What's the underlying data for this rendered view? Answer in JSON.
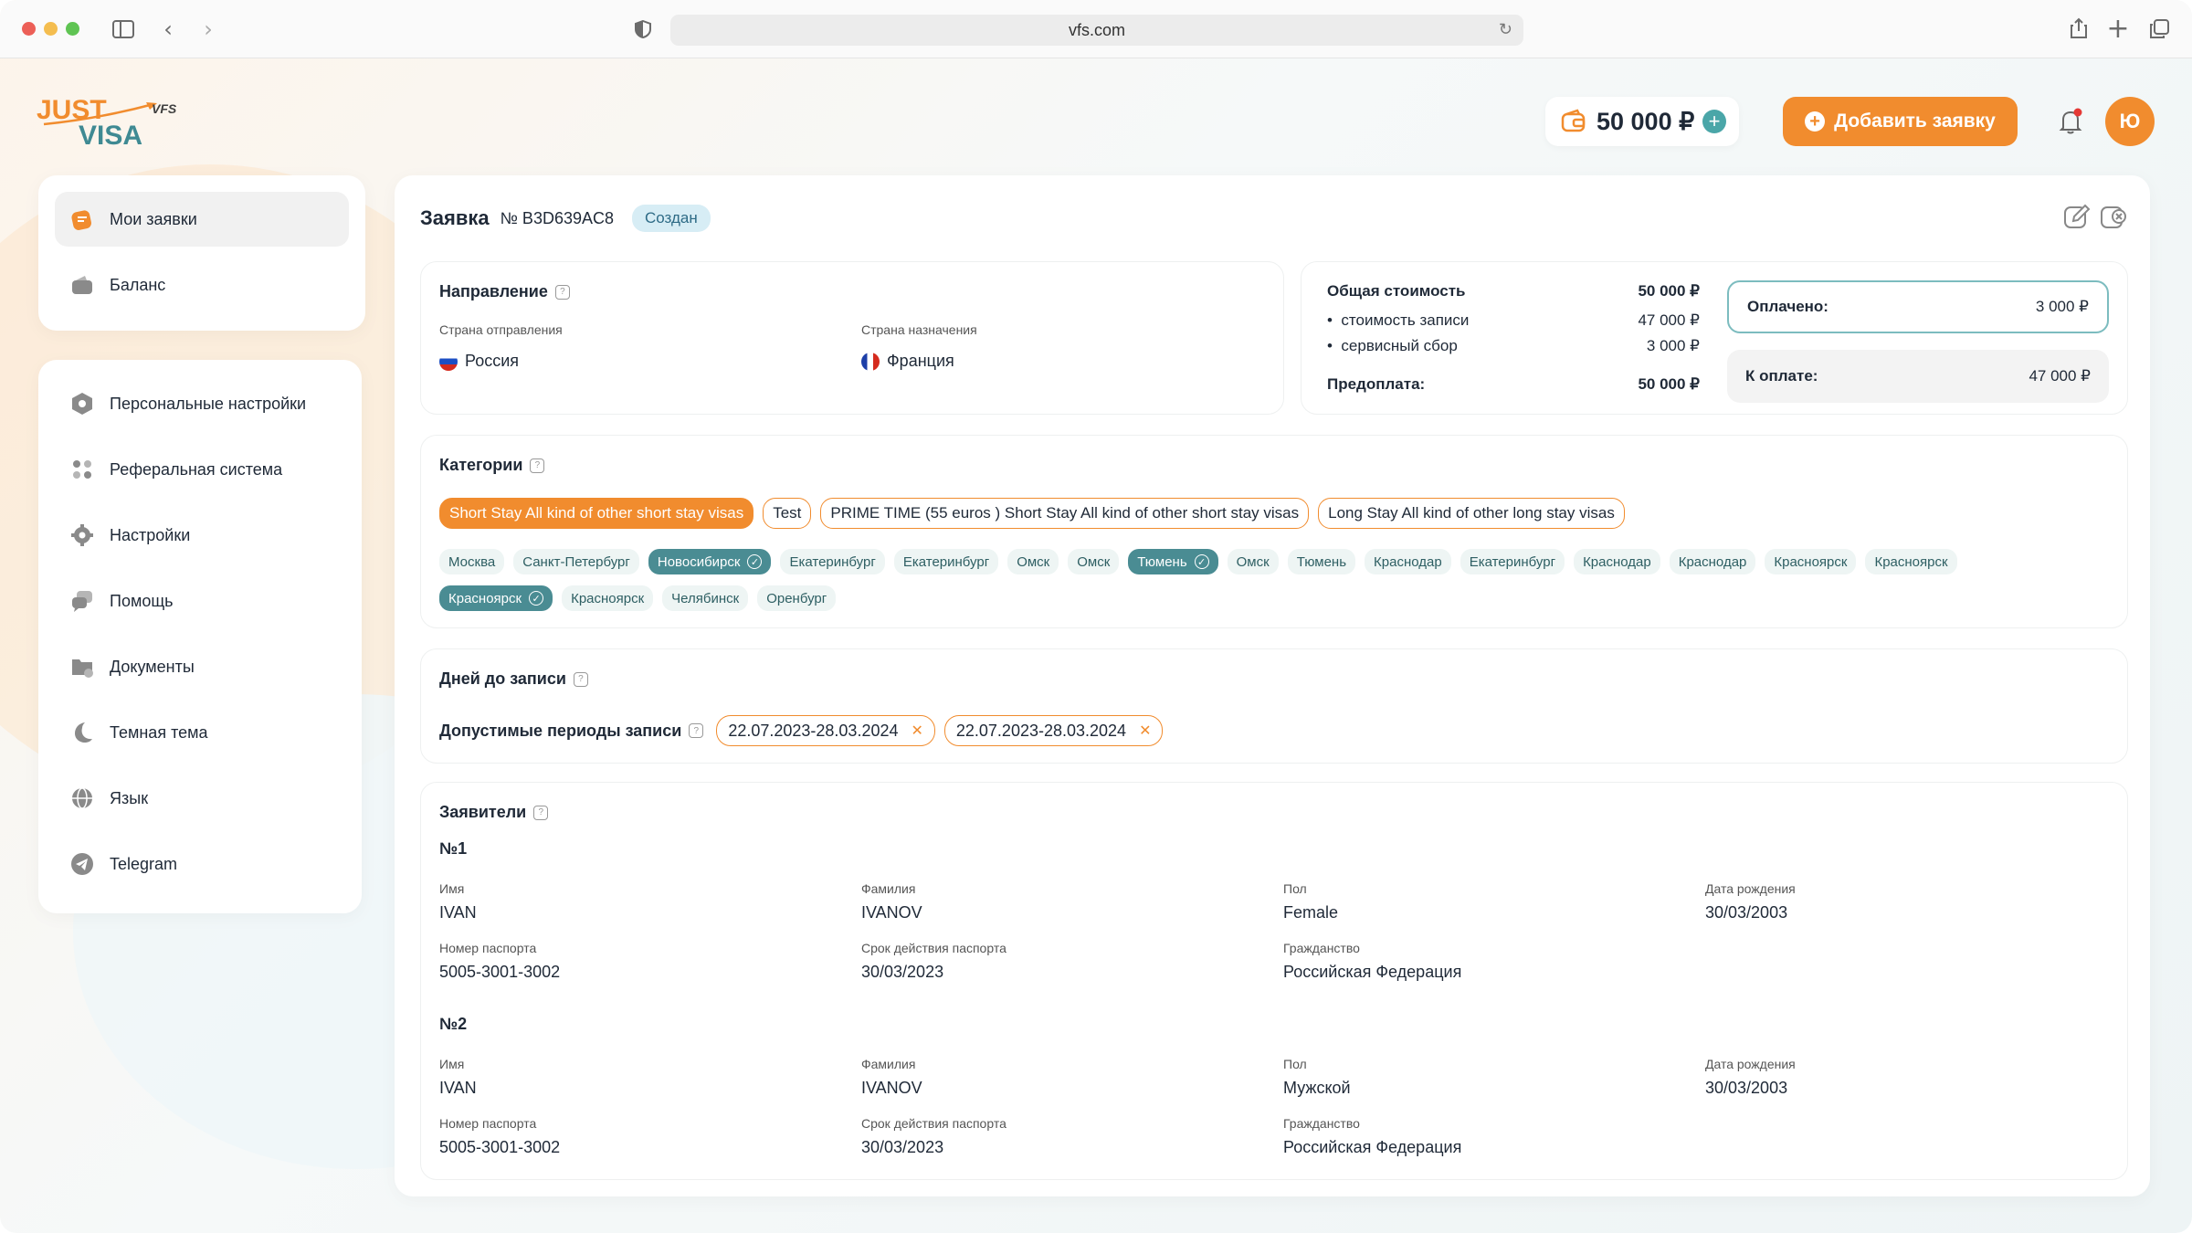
{
  "browser": {
    "url": "vfs.com"
  },
  "logo": {
    "just": "JUST",
    "visa": "VISA",
    "vfs": "VFS"
  },
  "header": {
    "balance": "50 000 ₽",
    "add_label": "Добавить заявку",
    "avatar": "Ю"
  },
  "sidebar": {
    "top": [
      {
        "label": "Мои заявки",
        "icon": "applications-icon",
        "active": true
      },
      {
        "label": "Баланс",
        "icon": "wallet-icon"
      }
    ],
    "items": [
      {
        "label": "Персональные настройки",
        "icon": "hexagon-icon"
      },
      {
        "label": "Реферальная система",
        "icon": "referral-icon"
      },
      {
        "label": "Настройки",
        "icon": "gear-icon"
      },
      {
        "label": "Помощь",
        "icon": "help-chat-icon"
      },
      {
        "label": "Документы",
        "icon": "folder-icon"
      },
      {
        "label": "Темная тема",
        "icon": "moon-icon"
      },
      {
        "label": "Язык",
        "icon": "globe-icon"
      },
      {
        "label": "Telegram",
        "icon": "telegram-icon"
      }
    ]
  },
  "application": {
    "title": "Заявка",
    "number": "№ B3D639AC8",
    "status": "Создан"
  },
  "direction": {
    "title": "Направление",
    "from_label": "Страна отправления",
    "from_value": "Россия",
    "to_label": "Страна назначения",
    "to_value": "Франция"
  },
  "cost": {
    "total_label": "Общая стоимость",
    "total_value": "50 000 ₽",
    "item1_label": "стоимость записи",
    "item1_value": "47 000 ₽",
    "item2_label": "сервисный сбор",
    "item2_value": "3 000 ₽",
    "prepay_label": "Предоплата:",
    "prepay_value": "50 000 ₽",
    "paid_label": "Оплачено:",
    "paid_value": "3 000 ₽",
    "due_label": "К оплате:",
    "due_value": "47 000 ₽"
  },
  "categories": {
    "title": "Категории",
    "types": [
      {
        "label": "Short Stay All kind of other short stay visas",
        "selected": true
      },
      {
        "label": "Test",
        "selected": false
      },
      {
        "label": "PRIME TIME (55 euros ) Short Stay All kind of other short stay visas",
        "selected": false
      },
      {
        "label": "Long Stay All kind of other long stay visas",
        "selected": false
      }
    ],
    "cities": [
      {
        "label": "Москва",
        "selected": false
      },
      {
        "label": "Санкт-Петербург",
        "selected": false
      },
      {
        "label": "Новосибирск",
        "selected": true
      },
      {
        "label": "Екатеринбург",
        "selected": false
      },
      {
        "label": "Екатеринбург",
        "selected": false
      },
      {
        "label": "Омск",
        "selected": false
      },
      {
        "label": "Омск",
        "selected": false
      },
      {
        "label": "Тюмень",
        "selected": true
      },
      {
        "label": "Омск",
        "selected": false
      },
      {
        "label": "Тюмень",
        "selected": false
      },
      {
        "label": "Краснодар",
        "selected": false
      },
      {
        "label": "Екатеринбург",
        "selected": false
      },
      {
        "label": "Краснодар",
        "selected": false
      },
      {
        "label": "Краснодар",
        "selected": false
      },
      {
        "label": "Красноярск",
        "selected": false
      },
      {
        "label": "Красноярск",
        "selected": false
      },
      {
        "label": "Красноярск",
        "selected": true
      },
      {
        "label": "Красноярск",
        "selected": false
      },
      {
        "label": "Челябинск",
        "selected": false
      },
      {
        "label": "Оренбург",
        "selected": false
      }
    ]
  },
  "days": {
    "title": "Дней до записи",
    "periods_label": "Допустимые периоды записи",
    "periods": [
      "22.07.2023-28.03.2024",
      "22.07.2023-28.03.2024"
    ]
  },
  "applicants": {
    "title": "Заявители",
    "labels": {
      "first_name": "Имя",
      "last_name": "Фамилия",
      "gender": "Пол",
      "birth_date": "Дата рождения",
      "passport_number": "Номер паспорта",
      "passport_expiry": "Срок действия паспорта",
      "citizenship": "Гражданство"
    },
    "list": [
      {
        "num": "№1",
        "first_name": "IVAN",
        "last_name": "IVANOV",
        "gender": "Female",
        "birth_date": "30/03/2003",
        "passport_number": "5005-3001-3002",
        "passport_expiry": "30/03/2023",
        "citizenship": "Российская Федерация"
      },
      {
        "num": "№2",
        "first_name": "IVAN",
        "last_name": "IVANOV",
        "gender": "Мужской",
        "birth_date": "30/03/2003",
        "passport_number": "5005-3001-3002",
        "passport_expiry": "30/03/2023",
        "citizenship": "Российская Федерация"
      }
    ]
  },
  "colors": {
    "accent": "#f18c2e",
    "teal": "#4a8c93",
    "status_bg": "#d7edf5"
  }
}
